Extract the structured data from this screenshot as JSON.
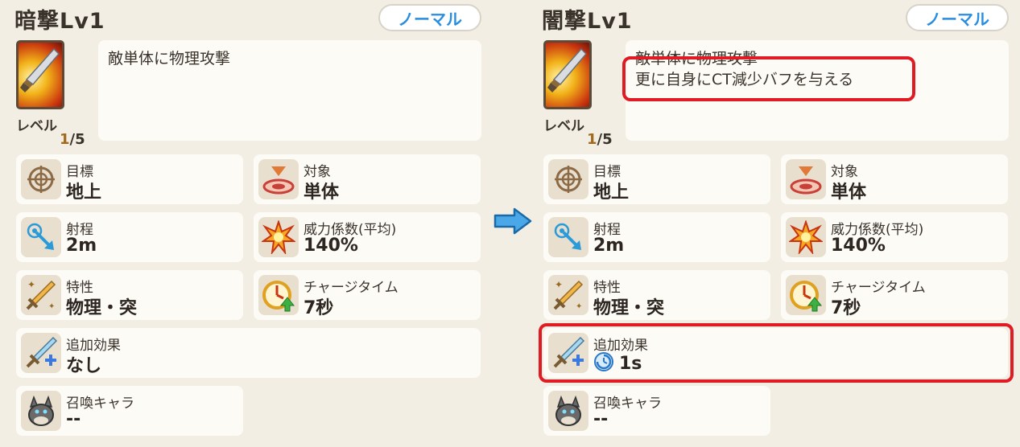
{
  "left": {
    "title": "暗撃Lv1",
    "rarity": "ノーマル",
    "level_label": "レベル",
    "level_current": "1",
    "level_max": "/5",
    "description_lines": [
      "敵単体に物理攻撃"
    ],
    "stats": {
      "target": {
        "label": "目標",
        "value": "地上"
      },
      "scope": {
        "label": "対象",
        "value": "単体"
      },
      "range": {
        "label": "射程",
        "value": "2m"
      },
      "power": {
        "label": "威力係数(平均)",
        "value": "140%"
      },
      "trait": {
        "label": "特性",
        "value": "物理・突"
      },
      "charge": {
        "label": "チャージタイム",
        "value": "7秒"
      },
      "extra": {
        "label": "追加効果",
        "value": "なし"
      },
      "summon": {
        "label": "召喚キャラ",
        "value": "--"
      }
    }
  },
  "right": {
    "title": "闇撃Lv1",
    "rarity": "ノーマル",
    "level_label": "レベル",
    "level_current": "1",
    "level_max": "/5",
    "description_lines": [
      "敵単体に物理攻撃",
      "更に自身にCT減少バフを与える"
    ],
    "stats": {
      "target": {
        "label": "目標",
        "value": "地上"
      },
      "scope": {
        "label": "対象",
        "value": "単体"
      },
      "range": {
        "label": "射程",
        "value": "2m"
      },
      "power": {
        "label": "威力係数(平均)",
        "value": "140%"
      },
      "trait": {
        "label": "特性",
        "value": "物理・突"
      },
      "charge": {
        "label": "チャージタイム",
        "value": "7秒"
      },
      "extra": {
        "label": "追加効果",
        "value": "1s"
      },
      "summon": {
        "label": "召喚キャラ",
        "value": "--"
      }
    }
  },
  "colors": {
    "rarity_text": "#2a8ee0",
    "highlight": "#e01b24",
    "level_current": "#a26a1e"
  }
}
